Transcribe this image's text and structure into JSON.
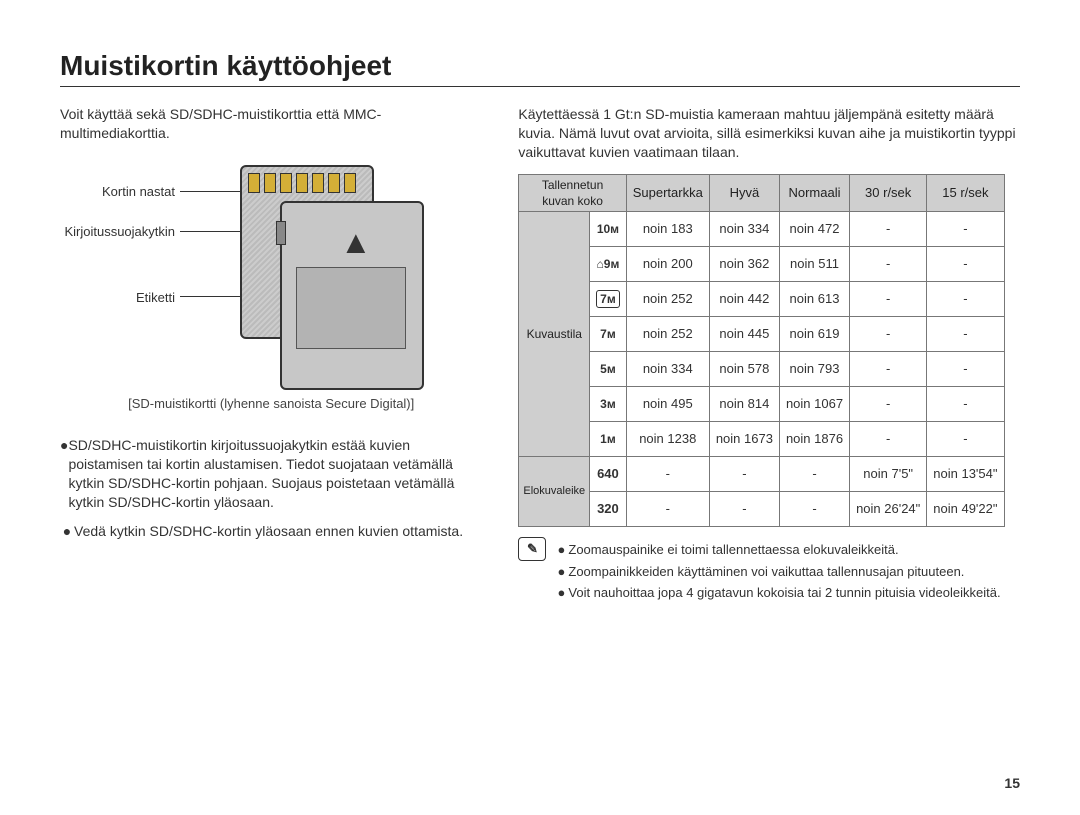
{
  "title": "Muistikortin käyttöohjeet",
  "page_number": "15",
  "left": {
    "intro": "Voit käyttää sekä SD/SDHC-muistikorttia että MMC-multimediakorttia.",
    "fig": {
      "l1": "Kortin nastat",
      "l2": "Kirjoitussuojakytkin",
      "l3": "Etiketti",
      "caption": "[SD-muistikortti (lyhenne sanoista Secure Digital)]"
    },
    "b1": "SD/SDHC-muistikortin kirjoitussuojakytkin estää kuvien poistamisen tai kortin alustamisen. Tiedot suojataan vetämällä kytkin SD/SDHC-kortin pohjaan. Suojaus poistetaan vetämällä kytkin SD/SDHC-kortin yläosaan.",
    "b2": "Vedä kytkin SD/SDHC-kortin yläosaan ennen kuvien ottamista."
  },
  "right": {
    "intro": "Käytettäessä 1 Gt:n SD-muistia kameraan mahtuu jäljempänä esitetty määrä kuvia. Nämä luvut ovat arvioita, sillä esimerkiksi kuvan aihe ja muistikortin tyyppi vaikuttavat kuvien vaatimaan tilaan.",
    "note1": "Zoomauspainike ei toimi tallennettaessa elokuvaleikkeitä.",
    "note2": "Zoompainikkeiden käyttäminen voi vaikuttaa tallennusajan pituuteen.",
    "note3": "Voit nauhoittaa jopa 4 gigatavun kokoisia tai 2 tunnin pituisia videoleikkeitä."
  },
  "chart_data": {
    "type": "table",
    "title": "1 Gt SD capacity",
    "col_group_header": "Tallennetun\nkuvan koko",
    "columns": [
      "Supertarkka",
      "Hyvä",
      "Normaali",
      "30 r/sek",
      "15 r/sek"
    ],
    "row_groups": [
      {
        "name": "Kuvaustila",
        "rows": [
          {
            "size": "10ᴍ",
            "cells": [
              "noin 183",
              "noin 334",
              "noin 472",
              "-",
              "-"
            ]
          },
          {
            "size": "⌂9ᴍ",
            "cells": [
              "noin 200",
              "noin 362",
              "noin 511",
              "-",
              "-"
            ]
          },
          {
            "size": "7ᴍ",
            "cells": [
              "noin 252",
              "noin 442",
              "noin 613",
              "-",
              "-"
            ]
          },
          {
            "size": "7ᴍ",
            "cells": [
              "noin 252",
              "noin 445",
              "noin 619",
              "-",
              "-"
            ]
          },
          {
            "size": "5ᴍ",
            "cells": [
              "noin 334",
              "noin 578",
              "noin 793",
              "-",
              "-"
            ]
          },
          {
            "size": "3ᴍ",
            "cells": [
              "noin 495",
              "noin 814",
              "noin 1067",
              "-",
              "-"
            ]
          },
          {
            "size": "1ᴍ",
            "cells": [
              "noin 1238",
              "noin 1673",
              "noin 1876",
              "-",
              "-"
            ]
          }
        ]
      },
      {
        "name": "Elokuvaleike",
        "rows": [
          {
            "size": "640",
            "cells": [
              "-",
              "-",
              "-",
              "noin 7'5\"",
              "noin 13'54\""
            ]
          },
          {
            "size": "320",
            "cells": [
              "-",
              "-",
              "-",
              "noin 26'24\"",
              "noin 49'22\""
            ]
          }
        ]
      }
    ]
  }
}
